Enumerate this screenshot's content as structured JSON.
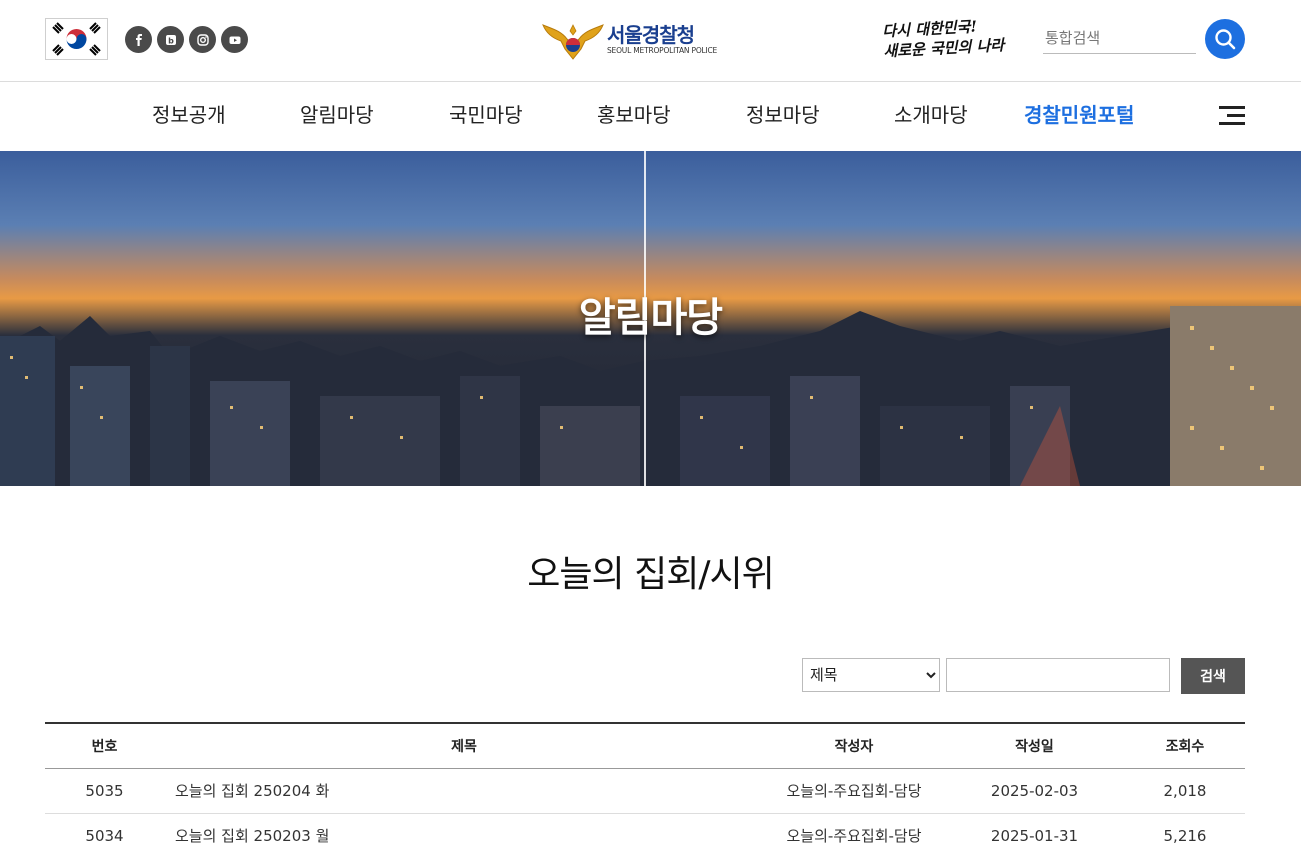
{
  "header": {
    "social_icons": [
      "facebook-icon",
      "blog-icon",
      "instagram-icon",
      "youtube-icon"
    ],
    "logo": {
      "name_ko": "서울경찰청",
      "name_en": "SEOUL METROPOLITAN POLICE"
    },
    "slogan": {
      "line1": "다시 대한민국!",
      "line2": "새로운 국민의 나라"
    },
    "search": {
      "placeholder": "통합검색"
    }
  },
  "gnb": {
    "items": [
      {
        "label": "정보공개"
      },
      {
        "label": "알림마당"
      },
      {
        "label": "국민마당"
      },
      {
        "label": "홍보마당"
      },
      {
        "label": "정보마당"
      },
      {
        "label": "소개마당"
      },
      {
        "label": "경찰민원포털"
      }
    ],
    "active_color": "#1d6fe0"
  },
  "banner": {
    "title": "알림마당"
  },
  "page": {
    "title": "오늘의 집회/시위"
  },
  "board_search": {
    "field_options": [
      "제목"
    ],
    "field_value": "제목",
    "query": "",
    "button_label": "검색"
  },
  "table": {
    "headers": {
      "num": "번호",
      "title": "제목",
      "author": "작성자",
      "date": "작성일",
      "views": "조회수"
    },
    "rows": [
      {
        "num": "5035",
        "title": "오늘의 집회 250204 화",
        "author": "오늘의-주요집회-담당",
        "date": "2025-02-03",
        "views": "2,018"
      },
      {
        "num": "5034",
        "title": "오늘의 집회 250203 월",
        "author": "오늘의-주요집회-담당",
        "date": "2025-01-31",
        "views": "5,216"
      }
    ]
  },
  "colors": {
    "accent": "#1d6fe0",
    "logo_blue": "#1a3f8f",
    "button_gray": "#555555"
  }
}
